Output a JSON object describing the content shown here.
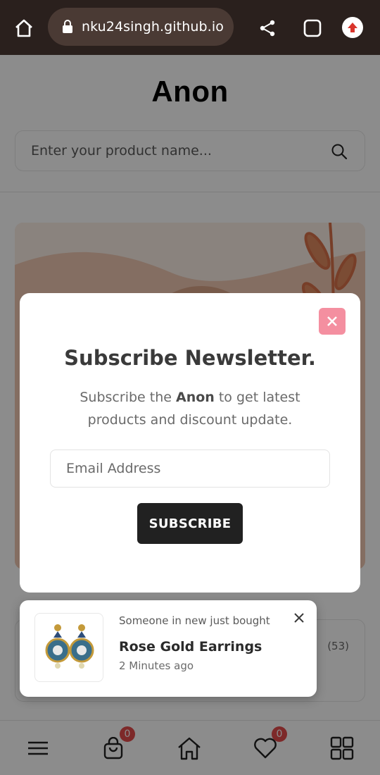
{
  "browser": {
    "url": "nku24singh.github.io",
    "icons": [
      "home-icon",
      "lock-icon",
      "share-icon",
      "tabs-icon",
      "update-icon"
    ]
  },
  "site": {
    "logo": "Anon",
    "search_placeholder": "Enter your product name..."
  },
  "product_card": {
    "review_count": "(53)"
  },
  "modal": {
    "title": "Subscribe Newsletter.",
    "desc_prefix": "Subscribe the ",
    "desc_brand": "Anon",
    "desc_suffix": " to get latest products and discount update.",
    "email_placeholder": "Email Address",
    "subscribe_label": "SUBSCRIBE",
    "close_color": "#f48fa0"
  },
  "toast": {
    "subtitle": "Someone in new just bought",
    "title": "Rose Gold Earrings",
    "time": "2 Minutes ago"
  },
  "bottom_nav": {
    "cart_count": "0",
    "wishlist_count": "0",
    "badge_color": "#e44b4b"
  }
}
